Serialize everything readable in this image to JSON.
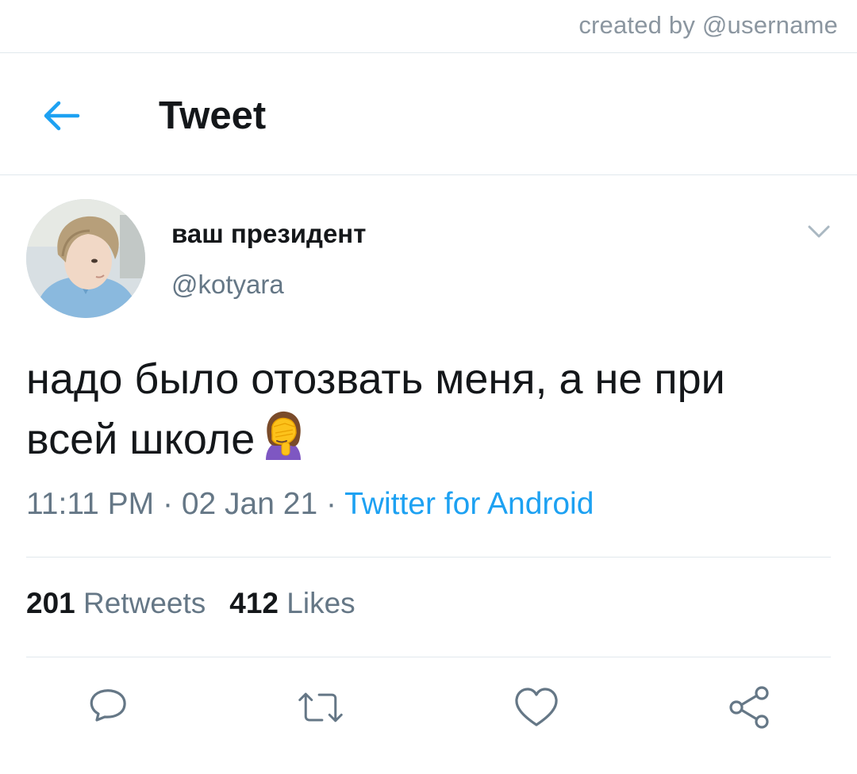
{
  "watermark": "created by @username",
  "header": {
    "title": "Tweet",
    "back_icon": "arrow-left-icon"
  },
  "tweet": {
    "display_name": "ваш президент",
    "handle": "@kotyara",
    "text": "надо было отозвать меня, а не при всей школе",
    "emoji": "woman-facepalming-icon",
    "time": "11:11 PM",
    "separator": " · ",
    "date": "02 Jan 21",
    "source": "Twitter for Android",
    "retweets_count": "201",
    "retweets_label": "Retweets",
    "likes_count": "412",
    "likes_label": "Likes"
  },
  "actions": [
    {
      "name": "reply",
      "icon": "reply-icon"
    },
    {
      "name": "retweet",
      "icon": "retweet-icon"
    },
    {
      "name": "like",
      "icon": "heart-icon"
    },
    {
      "name": "share",
      "icon": "share-icon"
    }
  ],
  "colors": {
    "accent": "#1da1f2",
    "text_primary": "#14171a",
    "text_secondary": "#657786",
    "divider": "#e1e8ed"
  }
}
